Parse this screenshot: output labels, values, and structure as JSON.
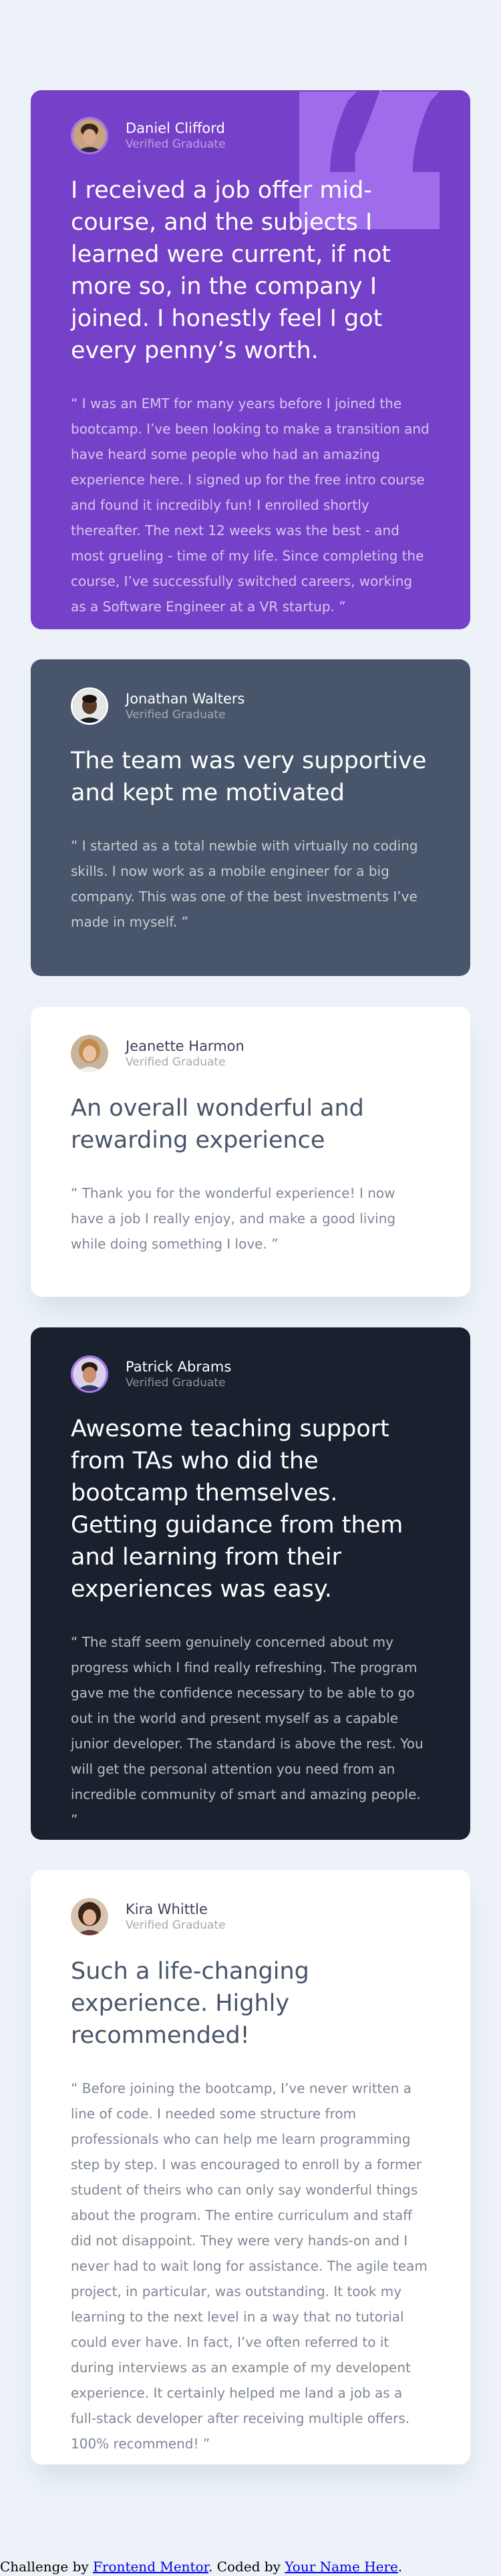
{
  "testimonials": [
    {
      "name": "Daniel Clifford",
      "role": "Verified Graduate",
      "headline": "I received a job offer mid-course, and the subjects I learned were current, if not more so, in the company I joined. I honestly feel I got every penny’s worth.",
      "body": "“ I was an EMT for many years before I joined the bootcamp. I’ve been looking to make a transition and have heard some people who had an amazing experience here. I signed up for the free intro course and found it incredibly fun! I enrolled shortly thereafter. The next 12 weeks was the best - and most grueling - time of my life. Since completing the course, I’ve successfully switched careers, working as a Software Engineer at a VR startup. ”",
      "accent": "#7541c8"
    },
    {
      "name": "Jonathan Walters",
      "role": "Verified Graduate",
      "headline": "The team was very supportive and kept me motivated",
      "body": "“ I started as a total newbie with virtually no coding skills. I now work as a mobile engineer for a big company. This was one of the best investments I’ve made in myself. ”",
      "accent": "#48556a"
    },
    {
      "name": "Jeanette Harmon",
      "role": "Verified Graduate",
      "headline": "An overall wonderful and rewarding experience",
      "body": "“ Thank you for the wonderful experience! I now have a job I really enjoy, and make a good living while doing something I love. ”",
      "accent": "#ffffff"
    },
    {
      "name": "Patrick Abrams",
      "role": "Verified Graduate",
      "headline": "Awesome teaching support from TAs who did the bootcamp themselves. Getting guidance from them and learning from their experiences was easy.",
      "body": "“ The staff seem genuinely concerned about my progress which I find really refreshing. The program gave me the confidence necessary to be able to go out in the world and present myself as a capable junior developer. The standard is above the rest. You will get the personal attention you need from an incredible community of smart and amazing people. ”",
      "accent": "#19212e"
    },
    {
      "name": "Kira Whittle",
      "role": "Verified Graduate",
      "headline": "Such a life-changing experience. Highly recommended!",
      "body": "“ Before joining the bootcamp, I’ve never written a line of code. I needed some structure from professionals who can help me learn programming step by step. I was encouraged to enroll by a former student of theirs who can only say wonderful things about the program. The entire curriculum and staff did not disappoint. They were very hands-on and I never had to wait long for assistance. The agile team project, in particular, was outstanding. It took my learning to the next level in a way that no tutorial could ever have. In fact, I’ve often referred to it during interviews as an example of my developent experience. It certainly helped me land a job as a full-stack developer after receiving multiple offers. 100% recommend! ”",
      "accent": "#ffffff"
    }
  ],
  "attribution": {
    "prefix": "Challenge by ",
    "link1": "Frontend Mentor",
    "middle": ". Coded by ",
    "link2": "Your Name Here",
    "suffix": "."
  },
  "icons": {
    "quote": "quotation-mark-icon"
  }
}
